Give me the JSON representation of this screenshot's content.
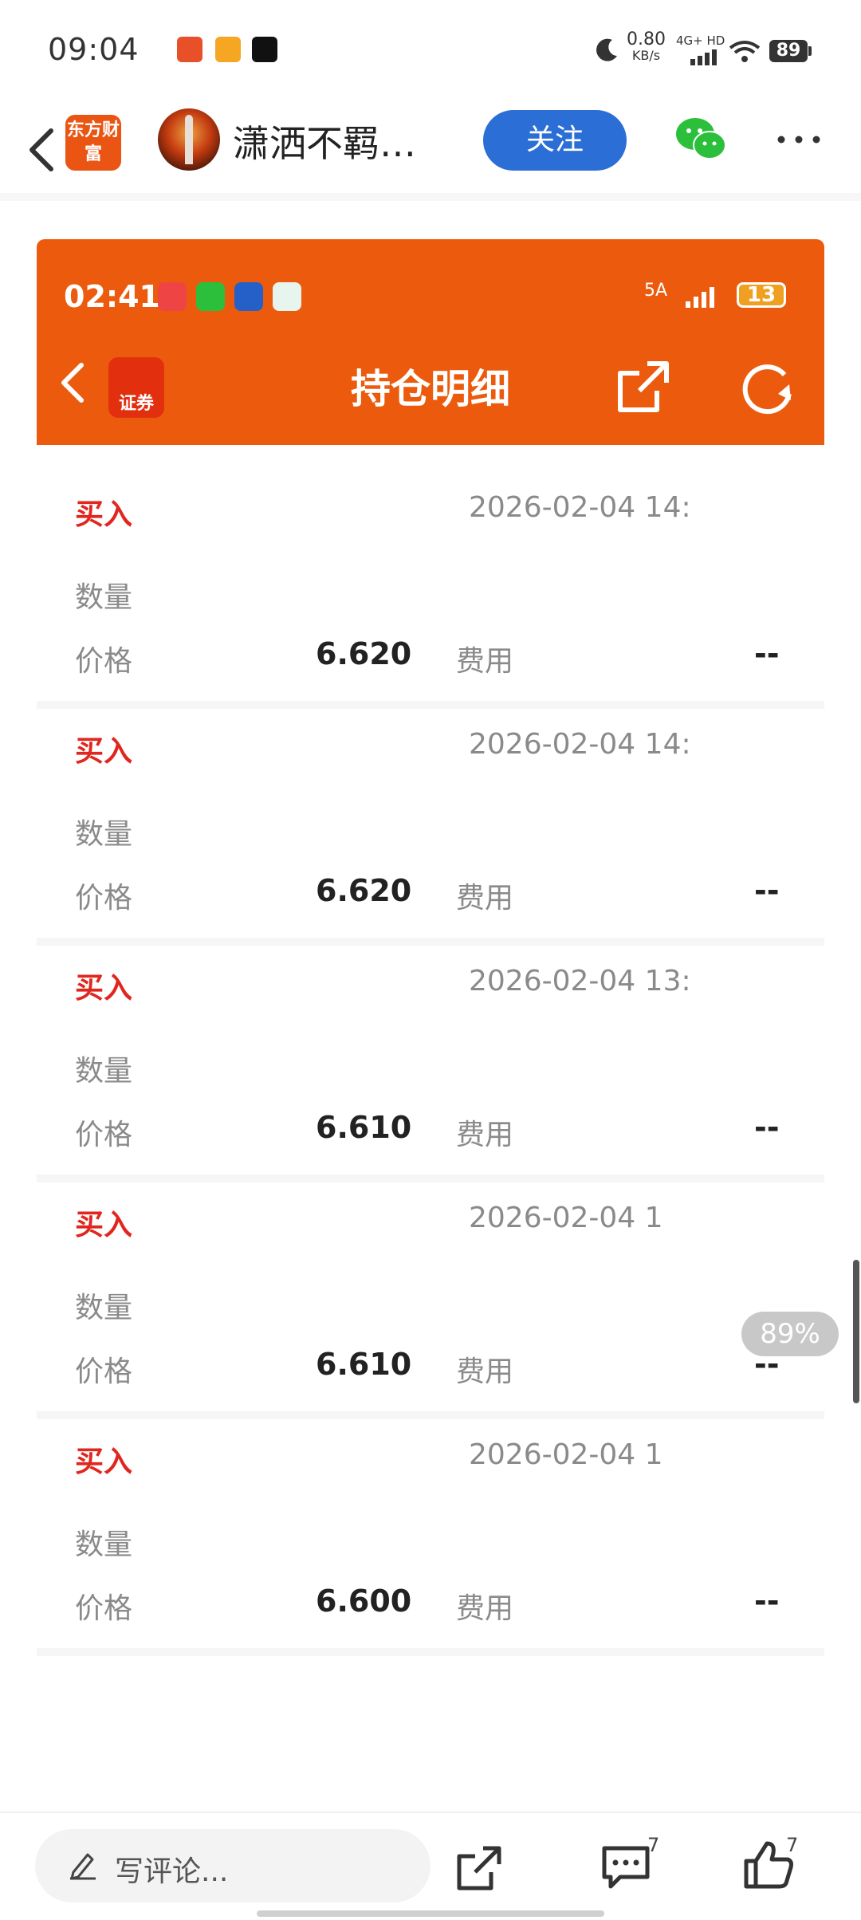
{
  "status_bar": {
    "time": "09:04",
    "net_speed": "0.80",
    "net_unit": "KB/s",
    "network": "4G+ HD",
    "battery": "89"
  },
  "header": {
    "logo_text": "东方财富",
    "username": "潇洒不羁…",
    "follow_label": "关注"
  },
  "embed": {
    "status_time": "02:41",
    "status_signal": "5A",
    "status_battery": "13",
    "logo_text": "证券",
    "title": "持仓明细",
    "records": [
      {
        "type": "买入",
        "date": "2026-02-04 14:",
        "qty_label": "数量",
        "price_label": "价格",
        "price": "6.620",
        "fee_label": "费用",
        "fee": "--"
      },
      {
        "type": "买入",
        "date": "2026-02-04 14:",
        "qty_label": "数量",
        "price_label": "价格",
        "price": "6.620",
        "fee_label": "费用",
        "fee": "--"
      },
      {
        "type": "买入",
        "date": "2026-02-04 13:",
        "qty_label": "数量",
        "price_label": "价格",
        "price": "6.610",
        "fee_label": "费用",
        "fee": "--"
      },
      {
        "type": "买入",
        "date": "2026-02-04 1",
        "qty_label": "数量",
        "price_label": "价格",
        "price": "6.610",
        "fee_label": "费用",
        "fee": "--"
      },
      {
        "type": "买入",
        "date": "2026-02-04 1",
        "qty_label": "数量",
        "price_label": "价格",
        "price": "6.600",
        "fee_label": "费用",
        "fee": "--"
      }
    ]
  },
  "scroll_percent": "89%",
  "bottom_bar": {
    "comment_placeholder": "写评论...",
    "comment_count": "7",
    "like_count": "7"
  },
  "colors": {
    "accent_orange": "#ec5b0d",
    "buy_red": "#e0261e",
    "follow_blue": "#2b6fd6"
  }
}
